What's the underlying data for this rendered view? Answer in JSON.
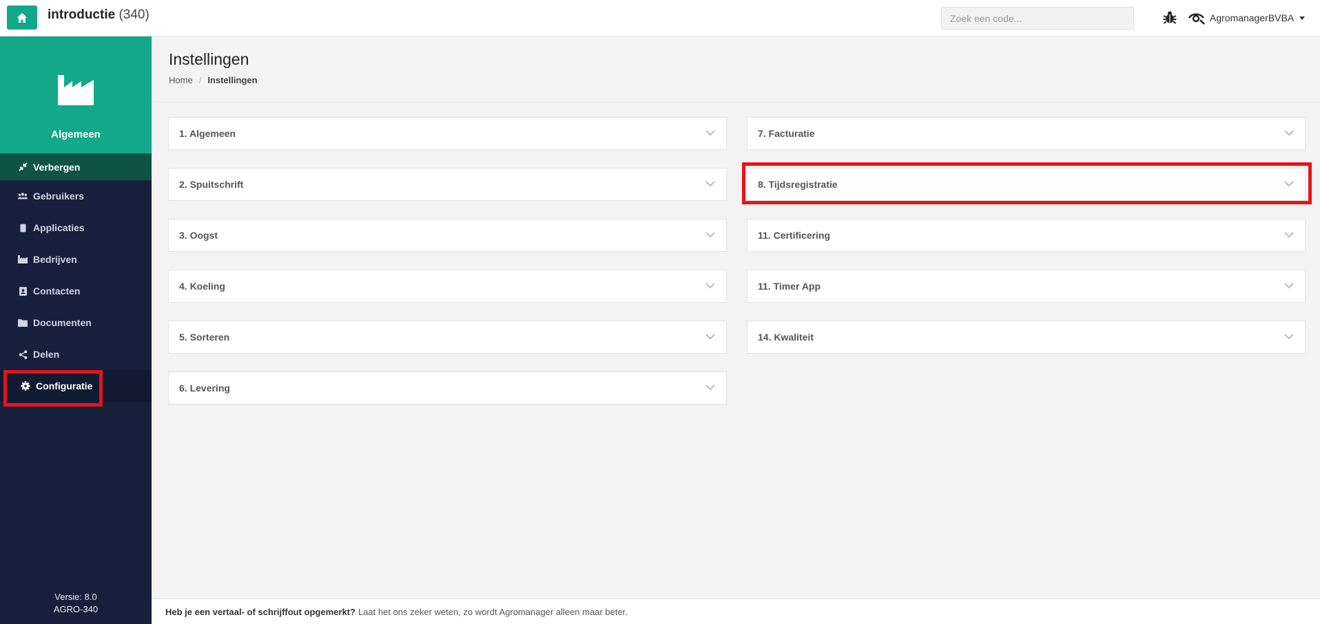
{
  "header": {
    "title_name": "introductie",
    "title_count": "(340)",
    "search_placeholder": "Zoek een code...",
    "user_name": "AgromanagerBVBA"
  },
  "sidebar": {
    "header_label": "Algemeen",
    "hide_label": "Verbergen",
    "items": [
      {
        "label": "Gebruikers",
        "icon": "users-icon"
      },
      {
        "label": "Applicaties",
        "icon": "mobile-icon"
      },
      {
        "label": "Bedrijven",
        "icon": "industry-icon"
      },
      {
        "label": "Contacten",
        "icon": "address-book-icon"
      },
      {
        "label": "Documenten",
        "icon": "folder-icon"
      },
      {
        "label": "Delen",
        "icon": "share-icon"
      },
      {
        "label": "Configuratie",
        "icon": "gear-icon"
      }
    ],
    "version_line1": "Versie: 8.0",
    "version_line2": "AGRO-340"
  },
  "page": {
    "title": "Instellingen",
    "breadcrumb": [
      "Home",
      "Instellingen"
    ]
  },
  "panels": {
    "left": [
      "1. Algemeen",
      "2. Spuitschrift",
      "3. Oogst",
      "4. Koeling",
      "5. Sorteren",
      "6. Levering"
    ],
    "right": [
      "7. Facturatie",
      "8. Tijdsregistratie",
      "11. Certificering",
      "11. Timer App",
      "14. Kwaliteit"
    ]
  },
  "footer": {
    "bold_text": "Heb je een vertaal- of schrijffout opgemerkt?",
    "text": "Laat het ons zeker weten, zo wordt Agromanager alleen maar beter."
  },
  "colors": {
    "accent": "#13a88a",
    "sidebar_bg": "#17203a",
    "highlight": "#e3151b"
  }
}
